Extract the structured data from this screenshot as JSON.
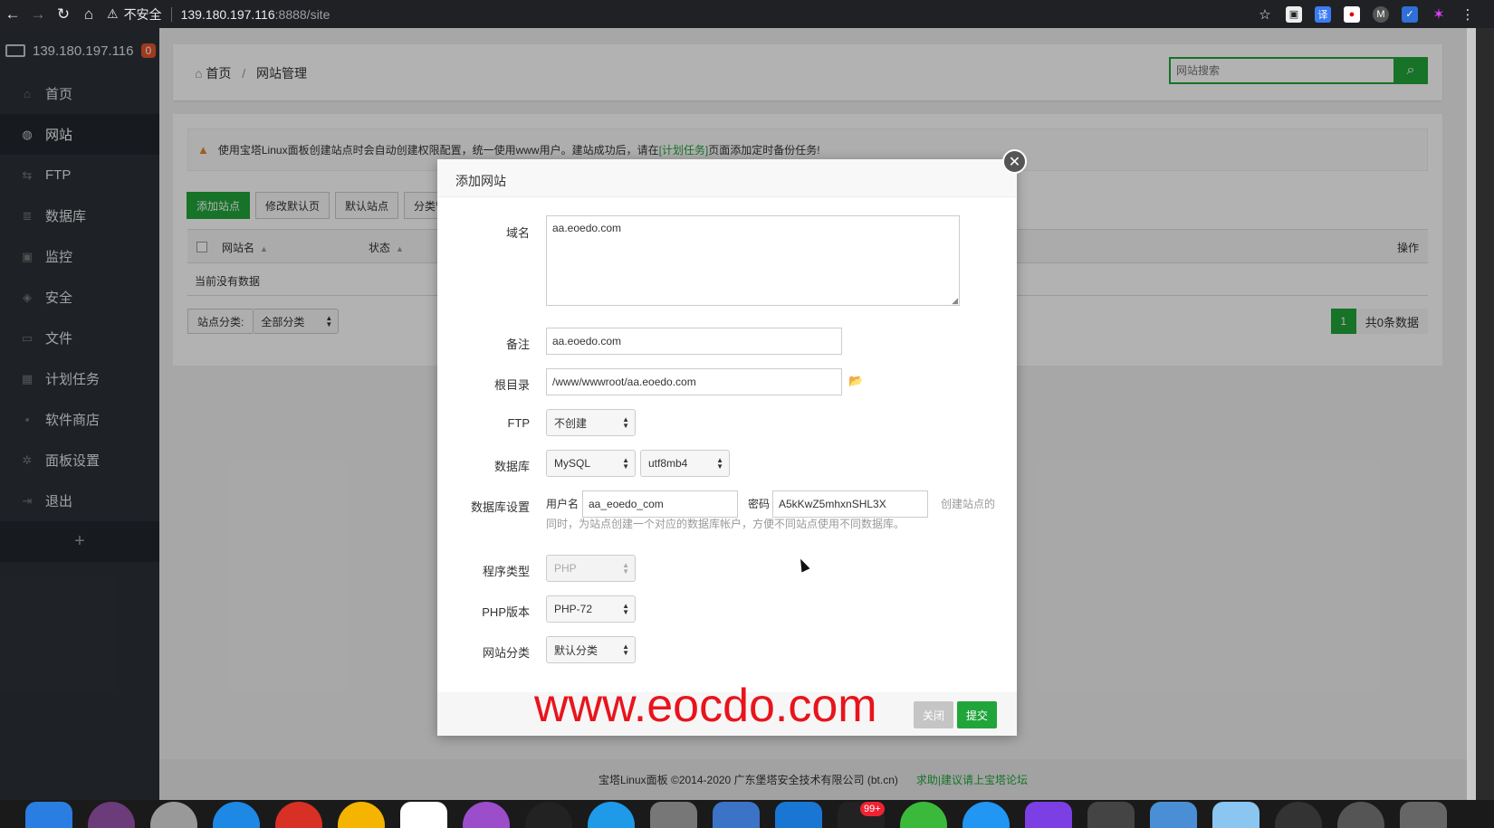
{
  "browser": {
    "insecure_label": "不安全",
    "url_host": "139.180.197.116",
    "url_rest": ":8888/site"
  },
  "sidebar": {
    "server_ip": "139.180.197.116",
    "badge": "0",
    "items": [
      {
        "label": "首页",
        "icon": "home-icon",
        "glyph": "⌂"
      },
      {
        "label": "网站",
        "icon": "globe-icon",
        "glyph": "◍"
      },
      {
        "label": "FTP",
        "icon": "ftp-icon",
        "glyph": "⇆"
      },
      {
        "label": "数据库",
        "icon": "database-icon",
        "glyph": "≣"
      },
      {
        "label": "监控",
        "icon": "monitor-icon",
        "glyph": "▣"
      },
      {
        "label": "安全",
        "icon": "shield-icon",
        "glyph": "◈"
      },
      {
        "label": "文件",
        "icon": "folder-icon",
        "glyph": "▭"
      },
      {
        "label": "计划任务",
        "icon": "calendar-icon",
        "glyph": "▦"
      },
      {
        "label": "软件商店",
        "icon": "apps-icon",
        "glyph": "▪"
      },
      {
        "label": "面板设置",
        "icon": "gear-icon",
        "glyph": "✲"
      },
      {
        "label": "退出",
        "icon": "logout-icon",
        "glyph": "⇥"
      }
    ],
    "active_index": 1,
    "add_glyph": "+"
  },
  "breadcrumb": {
    "home": "首页",
    "separator": "/",
    "current": "网站管理"
  },
  "search": {
    "placeholder": "网站搜索"
  },
  "notice": {
    "prefix": "使用宝塔Linux面板创建站点时会自动创建权限配置，统一使用www用户。建站成功后，请在",
    "link": "[计划任务]",
    "suffix": "页面添加定时备份任务!"
  },
  "toolbar": {
    "add_site": "添加站点",
    "modify_default": "修改默认页",
    "default_site": "默认站点",
    "category": "分类管"
  },
  "table": {
    "col_name": "网站名",
    "col_status": "状态",
    "col_ops": "操作",
    "empty": "当前没有数据"
  },
  "filter": {
    "label": "站点分类:",
    "value": "全部分类"
  },
  "pager": {
    "page": "1",
    "total": "共0条数据"
  },
  "footer": {
    "copyright": "宝塔Linux面板 ©2014-2020 广东堡塔安全技术有限公司 (bt.cn)",
    "link": "求助|建议请上宝塔论坛"
  },
  "modal": {
    "title": "添加网站",
    "domain_label": "域名",
    "domain_value": "aa.eoedo.com",
    "remark_label": "备注",
    "remark_value": "aa.eoedo.com",
    "root_label": "根目录",
    "root_value": "/www/wwwroot/aa.eoedo.com",
    "ftp_label": "FTP",
    "ftp_value": "不创建",
    "db_label": "数据库",
    "db_type": "MySQL",
    "db_charset": "utf8mb4",
    "dbset_label": "数据库设置",
    "db_user_label": "用户名",
    "db_user": "aa_eoedo_com",
    "db_pass_label": "密码",
    "db_pass": "A5kKwZ5mhxnSHL3X",
    "db_hint_1": "创建站点的",
    "db_hint_2": "同时，为站点创建一个对应的数据库帐户，方便不同站点使用不同数据库。",
    "prog_label": "程序类型",
    "prog_value": "PHP",
    "php_label": "PHP版本",
    "php_value": "PHP-72",
    "cat_label": "网站分类",
    "cat_value": "默认分类",
    "close_btn": "关闭",
    "submit_btn": "提交"
  },
  "watermark": "www.eocdo.com",
  "dock_badge": "99+",
  "colors": {
    "accent": "#20a53a",
    "sidebar": "#2c3138",
    "badge": "#e4532b",
    "watermark": "#e8141c"
  }
}
